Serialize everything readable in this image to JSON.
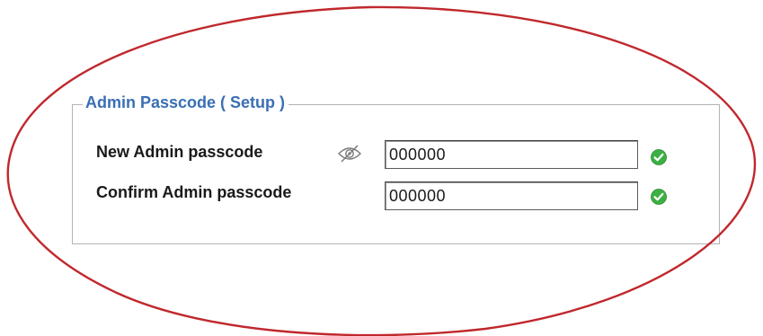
{
  "section": {
    "legend": "Admin Passcode ( Setup )"
  },
  "form": {
    "new_passcode": {
      "label": "New Admin passcode",
      "value": "000000",
      "status": "valid",
      "status_icon": "green-check-icon"
    },
    "confirm_passcode": {
      "label": "Confirm Admin passcode",
      "value": "000000",
      "status": "valid",
      "status_icon": "green-check-icon"
    },
    "visibility_toggle": {
      "icon": "eye-slash-icon",
      "state": "hidden"
    }
  },
  "annotation": {
    "type": "highlight-ellipse",
    "color": "#c0282d"
  },
  "colors": {
    "legend": "#3a6fb4",
    "valid": "#3cb043",
    "highlight": "#c0282d"
  }
}
